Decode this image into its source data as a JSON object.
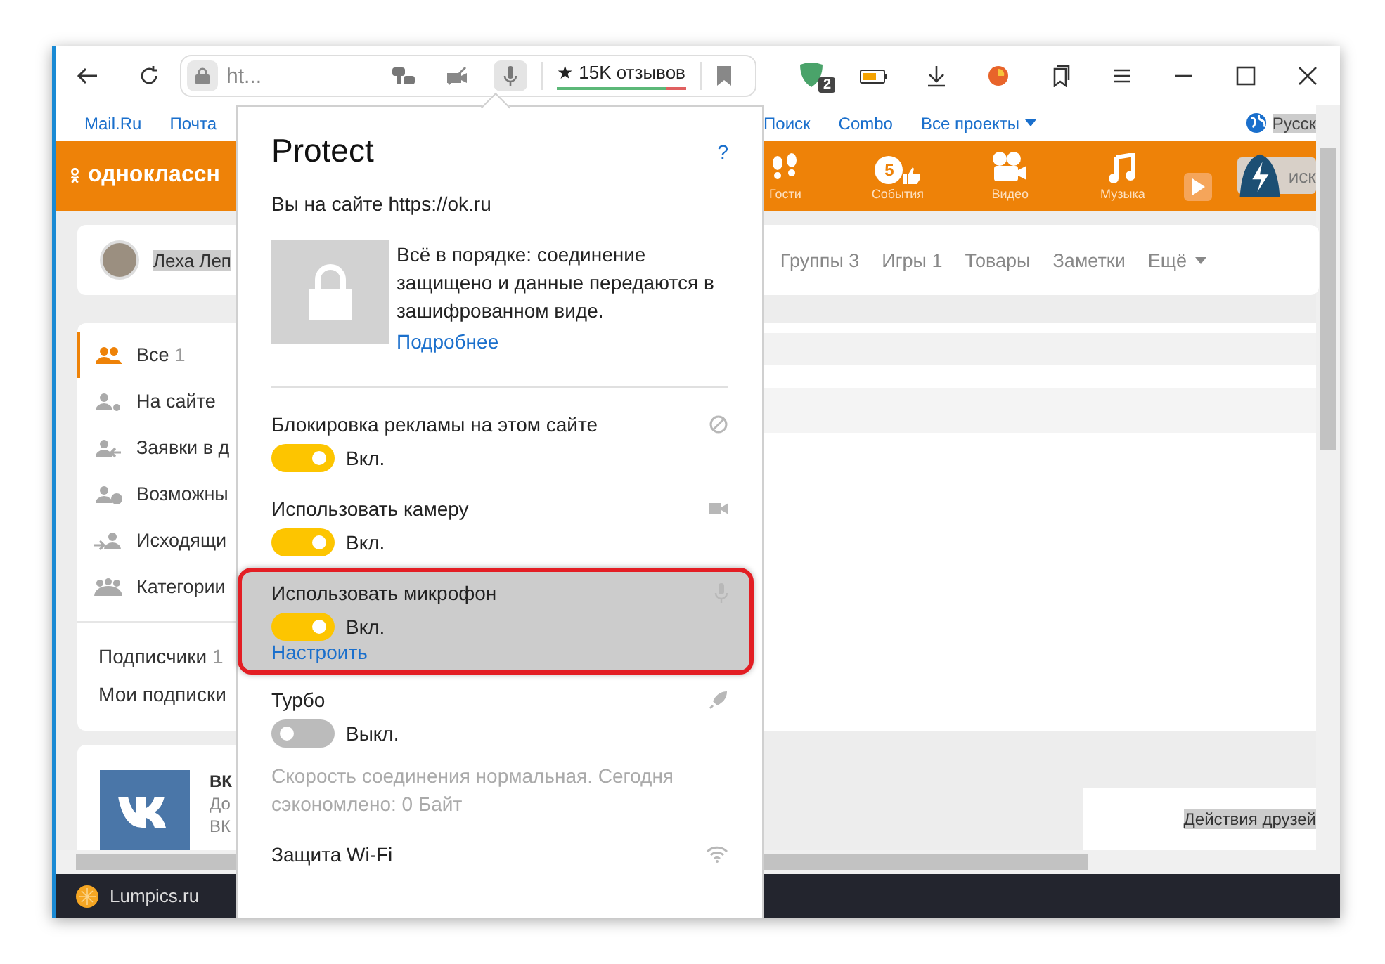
{
  "browser": {
    "address": "ht...",
    "address_icons": [
      {
        "kind": "keys",
        "active": false
      },
      {
        "kind": "camera",
        "active": false
      },
      {
        "kind": "mic",
        "active": true
      }
    ],
    "reviews": "★ 15K отзывов",
    "reviews_bar": {
      "level": 0.85
    },
    "extension_badge": "2"
  },
  "portal_links": [
    {
      "label": "Mail.Ru",
      "dropdown": false
    },
    {
      "label": "Почта",
      "dropdown": false
    },
    {
      "label": "Поиск",
      "dropdown": false
    },
    {
      "label": "Combo",
      "dropdown": false
    },
    {
      "label": "Все проекты",
      "dropdown": true
    }
  ],
  "language": {
    "label": "Русск",
    "highlighted": true
  },
  "site": {
    "logo_text": "одноклассн",
    "nav": [
      {
        "label": "Гости",
        "kind": "guests"
      },
      {
        "label": "События",
        "kind": "events",
        "badge": "5"
      },
      {
        "label": "Видео",
        "kind": "video"
      },
      {
        "label": "Музыка",
        "kind": "music"
      }
    ],
    "search_text": "иск"
  },
  "profile": {
    "name": "Леха Леп",
    "highlighted": true,
    "tabs": [
      {
        "label": "Группы 3",
        "dropdown": false
      },
      {
        "label": "Игры 1",
        "dropdown": false
      },
      {
        "label": "Товары",
        "dropdown": false
      },
      {
        "label": "Заметки",
        "dropdown": false
      },
      {
        "label": "Ещё",
        "dropdown": true
      }
    ]
  },
  "friends_menu": [
    {
      "label": "Все",
      "count": "1",
      "kind": "all",
      "selected": true
    },
    {
      "label": "На сайте",
      "kind": "online",
      "selected": false
    },
    {
      "label": "Заявки в д",
      "kind": "requests",
      "selected": false
    },
    {
      "label": "Возможны",
      "kind": "possible",
      "selected": false
    },
    {
      "label": "Исходящи",
      "kind": "outgoing",
      "selected": false
    },
    {
      "label": "Категории",
      "kind": "categories",
      "selected": false
    }
  ],
  "subscriptions": [
    {
      "label": "Подписчики",
      "count": "1"
    },
    {
      "label": "Мои подписки"
    }
  ],
  "vk_card": {
    "lines": [
      "ВК",
      "До",
      "ВК"
    ]
  },
  "friends_activity": {
    "label": "Действия друзей",
    "highlighted": true
  },
  "status_bar": {
    "tab": "Lumpics.ru"
  },
  "popup": {
    "title": "Protect",
    "help": "?",
    "site_line": "Вы на сайте https://ok.ru",
    "status_text": "Всё в порядке: соединение защищено и данные передаются в зашифрованном виде.",
    "more_link": "Подробнее",
    "permissions": [
      {
        "label": "Блокировка рекламы на этом сайте",
        "kind": "adblock",
        "on": true,
        "state": "Вкл.",
        "highlighted": false
      },
      {
        "label": "Использовать камеру",
        "kind": "camera",
        "on": true,
        "state": "Вкл.",
        "highlighted": false
      },
      {
        "label": "Использовать микрофон",
        "kind": "mic",
        "on": true,
        "state": "Вкл.",
        "link": "Настроить",
        "highlighted": true
      },
      {
        "label": "Турбо",
        "kind": "turbo",
        "on": false,
        "state": "Выкл.",
        "description": "Скорость соединения нормальная. Сегодня сэкономлено: 0 Байт",
        "highlighted": false
      },
      {
        "label": "Защита Wi-Fi",
        "kind": "wifi",
        "highlighted": false
      }
    ]
  }
}
